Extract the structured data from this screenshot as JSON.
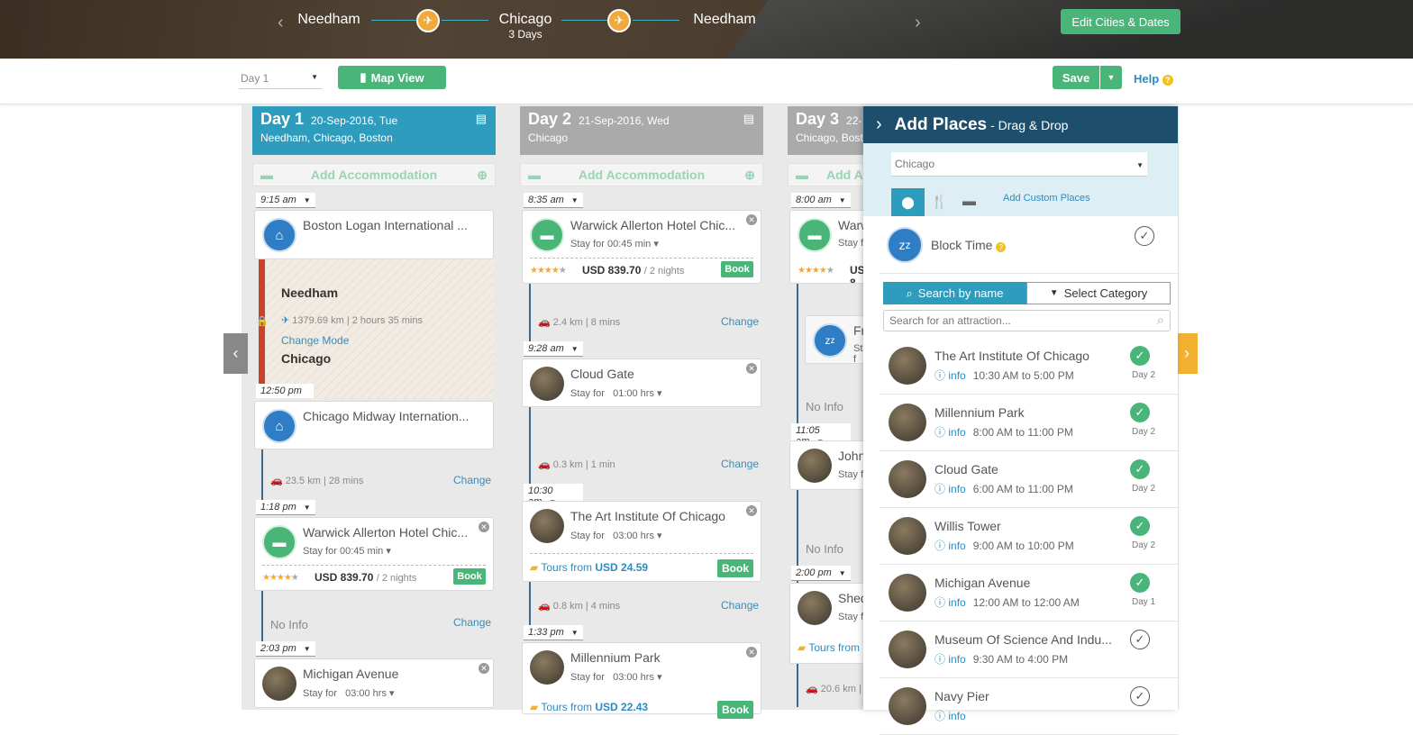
{
  "header": {
    "cities": [
      {
        "name": "Needham",
        "days": ""
      },
      {
        "name": "Chicago",
        "days": "3 Days"
      },
      {
        "name": "Needham",
        "days": ""
      }
    ],
    "edit_button": "Edit Cities & Dates"
  },
  "toolbar": {
    "day_select": "Day 1",
    "map_view": "Map View",
    "save": "Save",
    "help": "Help"
  },
  "add_accommodation": "Add Accommodation",
  "days": [
    {
      "title": "Day 1",
      "date": "20-Sep-2016, Tue",
      "cities": "Needham, Chicago, Boston",
      "color": "#2e9cbd",
      "t1": "9:15 am",
      "c1": "Boston Logan International ...",
      "transfer_from": "Needham",
      "transfer_info": "1379.69 km | 2 hours 35 mins",
      "transfer_change": "Change Mode",
      "transfer_to": "Chicago",
      "t2": "12:50 pm",
      "c2": "Chicago Midway Internation...",
      "travel1": "23.5 km | 28 mins",
      "t3": "1:18 pm",
      "c3": "Warwick Allerton Hotel Chic...",
      "c3_stay": "Stay for 00:45 min",
      "c3_price": "USD 839.70",
      "c3_nights": "/ 2 nights",
      "c3_book": "Book",
      "noinfo": "No Info",
      "t4": "2:03 pm",
      "c4": "Michigan Avenue",
      "c4_stay_label": "Stay for",
      "c4_stay": "03:00 hrs"
    },
    {
      "title": "Day 2",
      "date": "21-Sep-2016, Wed",
      "cities": "Chicago",
      "color": "#aaaaaa",
      "t1": "8:35 am",
      "c1": "Warwick Allerton Hotel Chic...",
      "c1_stay": "Stay for 00:45 min",
      "c1_price": "USD 839.70",
      "c1_nights": "/ 2 nights",
      "c1_book": "Book",
      "travel1": "2.4 km | 8 mins",
      "t2": "9:28 am",
      "c2": "Cloud Gate",
      "c2_stay_label": "Stay for",
      "c2_stay": "01:00 hrs",
      "travel2": "0.3 km | 1 min",
      "t3": "10:30 am",
      "c3": "The Art Institute Of Chicago",
      "c3_stay_label": "Stay for",
      "c3_stay": "03:00 hrs",
      "c3_tours": "Tours from",
      "c3_tour_price": "USD 24.59",
      "c3_book": "Book",
      "travel3": "0.8 km | 4 mins",
      "t4": "1:33 pm",
      "c4": "Millennium Park",
      "c4_stay_label": "Stay for",
      "c4_stay": "03:00 hrs",
      "c4_tours": "Tours from",
      "c4_tour_price": "USD 22.43",
      "c4_book": "Book"
    },
    {
      "title": "Day 3",
      "date": "22-",
      "cities": "Chicago, Bosto",
      "color": "#aaaaaa",
      "t1": "8:00 am",
      "c1": "Warwick",
      "c1_stay": "Stay fo",
      "c1_price": "USD 8",
      "c2": "Free",
      "c2_stay": "Stay f",
      "noinfo1": "No Info",
      "t3": "11:05 am",
      "c3": "John Ha",
      "c3_stay": "Stay for",
      "noinfo2": "No Info",
      "t4": "2:00 pm",
      "c4": "Shedd A",
      "c4_stay": "Stay for",
      "c4_tours": "Tours from",
      "c4_tour_price": "U",
      "travel4": "20.6 km | 26"
    }
  ],
  "change": "Change",
  "panel": {
    "title": "Add Places",
    "subtitle": "- Drag & Drop",
    "city": "Chicago",
    "add_custom": "Add Custom Places",
    "block_time": "Block Time",
    "search_by_name": "Search by name",
    "select_category": "Select Category",
    "search_placeholder": "Search for an attraction...",
    "info_label": "info",
    "places": [
      {
        "name": "The Art Institute Of Chicago",
        "hours": "10:30 AM to 5:00 PM",
        "day": "Day 2",
        "added": true
      },
      {
        "name": "Millennium Park",
        "hours": "8:00 AM to 11:00 PM",
        "day": "Day 2",
        "added": true
      },
      {
        "name": "Cloud Gate",
        "hours": "6:00 AM to 11:00 PM",
        "day": "Day 2",
        "added": true
      },
      {
        "name": "Willis Tower",
        "hours": "9:00 AM to 10:00 PM",
        "day": "Day 2",
        "added": true
      },
      {
        "name": "Michigan Avenue",
        "hours": "12:00 AM to 12:00 AM",
        "day": "Day 1",
        "added": true
      },
      {
        "name": "Museum Of Science And Indu...",
        "hours": "9:30 AM to 4:00 PM",
        "day": "",
        "added": false
      },
      {
        "name": "Navy Pier",
        "hours": "",
        "day": "",
        "added": false
      }
    ]
  }
}
